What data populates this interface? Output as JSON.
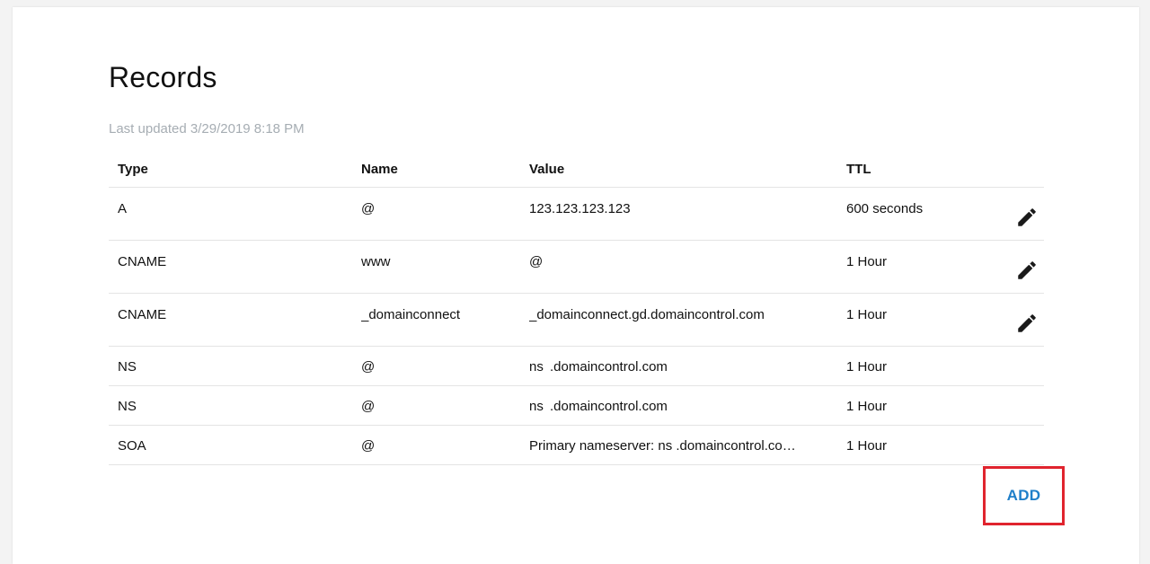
{
  "page": {
    "title": "Records",
    "last_updated": "Last updated 3/29/2019 8:18 PM"
  },
  "table": {
    "headers": {
      "type": "Type",
      "name": "Name",
      "value": "Value",
      "ttl": "TTL"
    },
    "rows": [
      {
        "type": "A",
        "name": "@",
        "value": "123.123.123.123",
        "ttl": "600 seconds",
        "editable": true
      },
      {
        "type": "CNAME",
        "name": "www",
        "value": "@",
        "ttl": "1 Hour",
        "editable": true
      },
      {
        "type": "CNAME",
        "name": "_domainconnect",
        "value": "_domainconnect.gd.domaincontrol.com",
        "ttl": "1 Hour",
        "editable": true
      },
      {
        "type": "NS",
        "name": "@",
        "value": "ns  .domaincontrol.com",
        "ttl": "1 Hour",
        "editable": false
      },
      {
        "type": "NS",
        "name": "@",
        "value": "ns  .domaincontrol.com",
        "ttl": "1 Hour",
        "editable": false
      },
      {
        "type": "SOA",
        "name": "@",
        "value": "Primary nameserver: ns      .domaincontrol.co…",
        "ttl": "1 Hour",
        "editable": false
      }
    ]
  },
  "actions": {
    "add_label": "ADD"
  },
  "colors": {
    "accent": "#1f7fc9",
    "highlight_border": "#e0242e",
    "muted_text": "#a6adb3"
  },
  "icons": {
    "edit": "pencil-icon"
  }
}
